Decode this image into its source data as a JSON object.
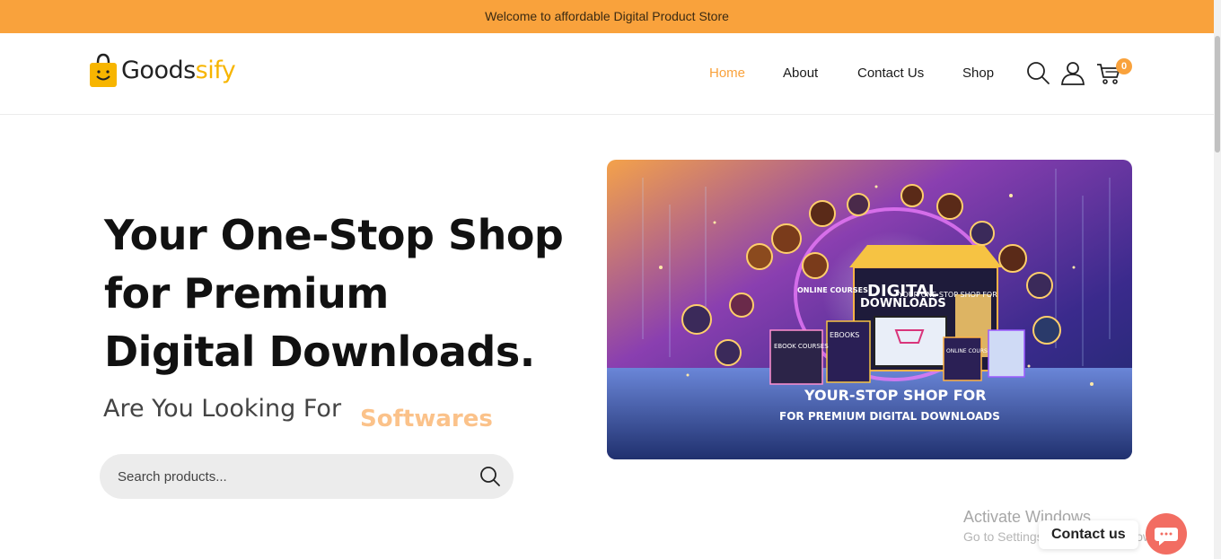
{
  "topbar": {
    "text": "Welcome to affordable Digital Product Store"
  },
  "logo": {
    "brand_a": "Goods",
    "brand_b": "sify"
  },
  "nav": {
    "items": [
      {
        "label": "Home",
        "active": true
      },
      {
        "label": "About",
        "active": false
      },
      {
        "label": "Contact Us",
        "active": false
      },
      {
        "label": "Shop",
        "active": false
      }
    ],
    "cart_count": "0"
  },
  "hero": {
    "title_lines": [
      "Your One-Stop Shop",
      "for Premium",
      "Digital Downloads."
    ],
    "looking_for": "Are You Looking For",
    "rotating_word": "Softwares",
    "search_placeholder": "Search products..."
  },
  "banner": {
    "sign_top": "YOUR ONE-STOP SHOP FOR",
    "sign_main_1": "DIGITAL",
    "sign_main_2": "DOWNLOADS",
    "label_ebooks": "EBOOKS",
    "label_ebook_courses": "EBOOK COURSES",
    "label_online_courses": "ONLINE COURSES",
    "label_online_courses_2": "ONLINE COURSES",
    "tagline_1": "YOUR-STOP SHOP FOR",
    "tagline_2": "FOR PREMIUM DIGITAL DOWNLOADS"
  },
  "overlay": {
    "watermark_1": "Activate Windows",
    "watermark_2": "Go to Settings to activate Windows.",
    "contact_label": "Contact us"
  },
  "colors": {
    "accent": "#f9a23c",
    "logo_yellow": "#f7b500",
    "chat": "#f26d62"
  }
}
